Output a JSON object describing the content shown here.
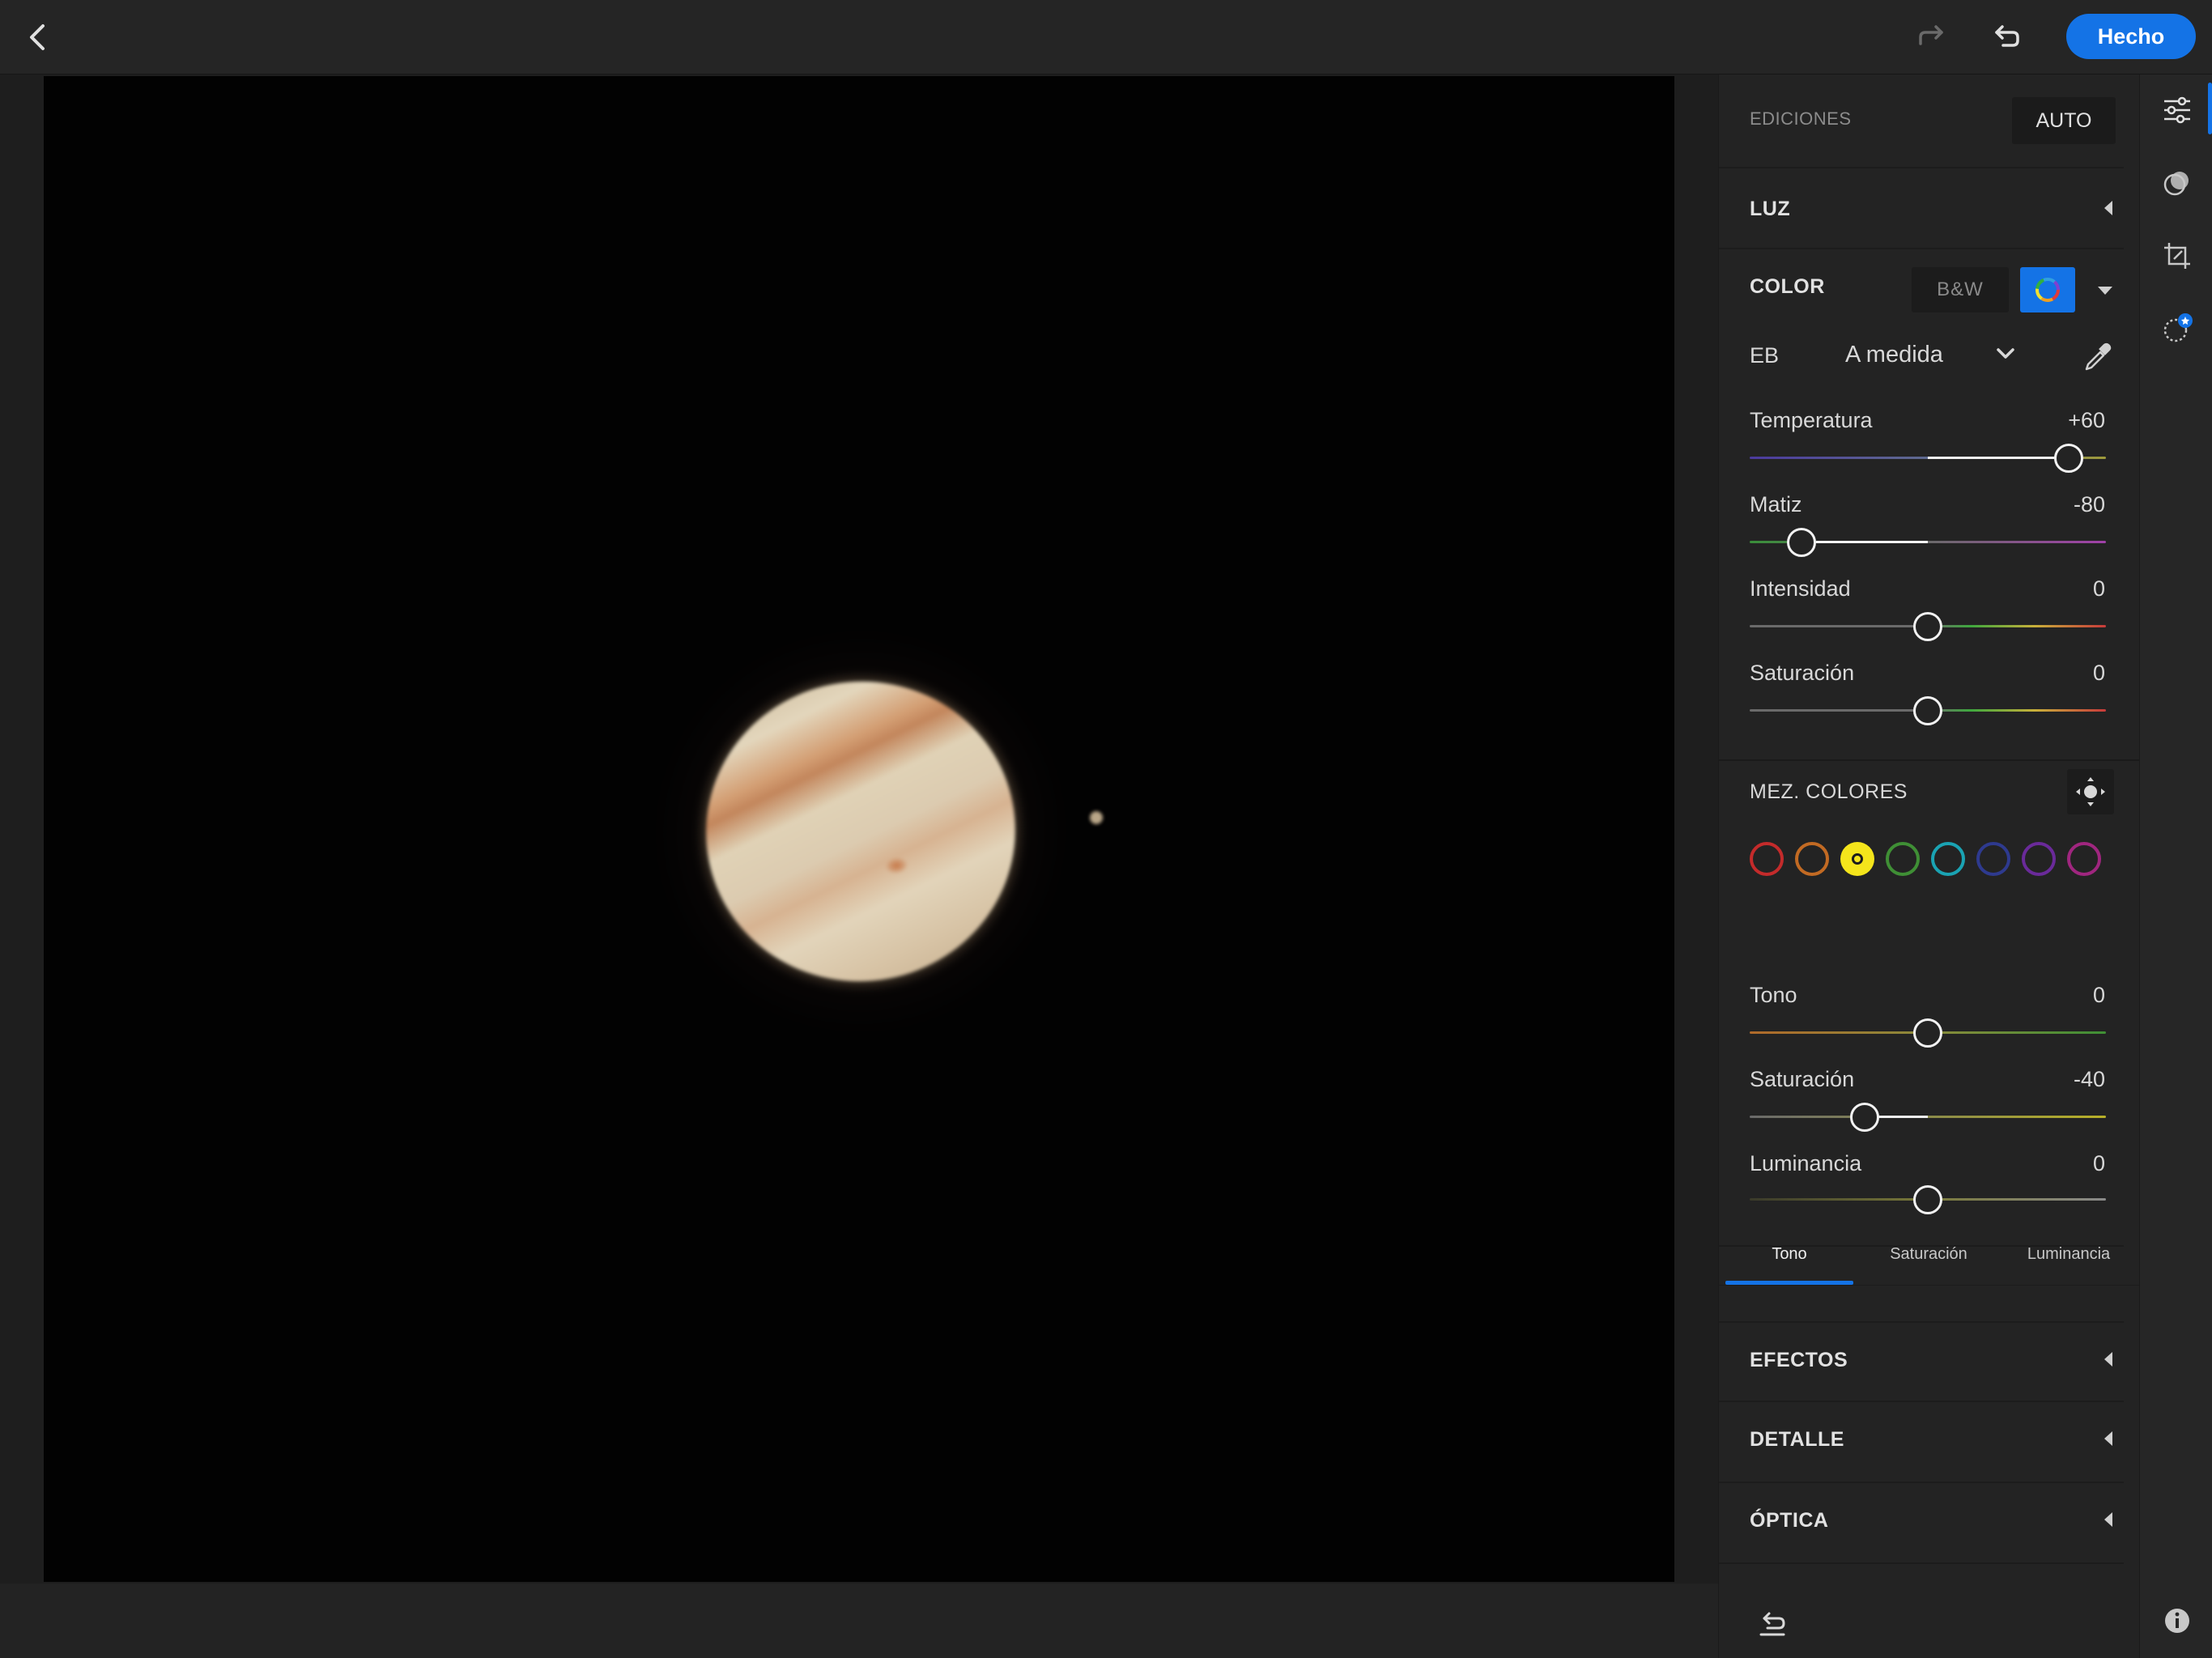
{
  "toolbar": {
    "done_label": "Hecho",
    "colors": {
      "accent": "#1473e6"
    }
  },
  "panel": {
    "ediciones_label": "EDICIONES",
    "auto_label": "AUTO",
    "sections": {
      "luz": "LUZ",
      "color": "COLOR",
      "efectos": "EFECTOS",
      "detalle": "DETALLE",
      "optica": "ÓPTICA"
    },
    "color": {
      "bw_label": "B&W",
      "eb_label": "EB",
      "eb_value": "A medida",
      "sliders": [
        {
          "label": "Temperatura",
          "value": "+60",
          "numeric": 60,
          "min": -100,
          "max": 100
        },
        {
          "label": "Matiz",
          "value": "-80",
          "numeric": -80,
          "min": -100,
          "max": 100
        },
        {
          "label": "Intensidad",
          "value": "0",
          "numeric": 0,
          "min": -100,
          "max": 100
        },
        {
          "label": "Saturación",
          "value": "0",
          "numeric": 0,
          "min": -100,
          "max": 100
        }
      ]
    },
    "mixer": {
      "title": "MEZ. COLORES",
      "swatches": [
        {
          "name": "red",
          "color": "#c42b2b",
          "selected": false
        },
        {
          "name": "orange",
          "color": "#c26a23",
          "selected": false
        },
        {
          "name": "yellow",
          "color": "#f5e51b",
          "selected": true
        },
        {
          "name": "green",
          "color": "#3f8f35",
          "selected": false
        },
        {
          "name": "aqua",
          "color": "#1aa3b3",
          "selected": false
        },
        {
          "name": "blue",
          "color": "#2e3a8f",
          "selected": false
        },
        {
          "name": "purple",
          "color": "#6a2a9a",
          "selected": false
        },
        {
          "name": "magenta",
          "color": "#a0267f",
          "selected": false
        }
      ],
      "sliders": [
        {
          "label": "Tono",
          "value": "0",
          "numeric": 0,
          "min": -100,
          "max": 100
        },
        {
          "label": "Saturación",
          "value": "-40",
          "numeric": -40,
          "min": -100,
          "max": 100
        },
        {
          "label": "Luminancia",
          "value": "0",
          "numeric": 0,
          "min": -100,
          "max": 100
        }
      ],
      "tabs": [
        "Tono",
        "Saturación",
        "Luminancia"
      ],
      "active_tab": "Tono"
    }
  }
}
